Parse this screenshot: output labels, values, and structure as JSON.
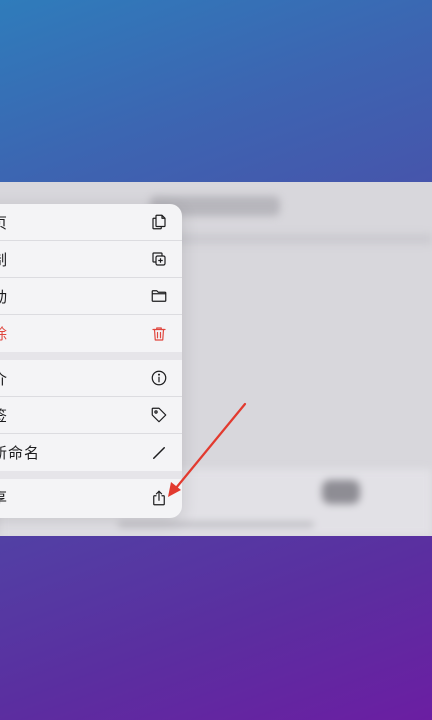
{
  "colors": {
    "danger": "#e0463e",
    "text": "#1c1c1e",
    "annotation_arrow": "#e23a2f"
  },
  "menu": {
    "groups": [
      {
        "items": [
          {
            "label": "页",
            "icon": "copy-pages-icon"
          },
          {
            "label": "制",
            "icon": "duplicate-icon"
          },
          {
            "label": "动",
            "icon": "folder-icon"
          },
          {
            "label": "除",
            "icon": "trash-icon",
            "danger": true
          }
        ]
      },
      {
        "items": [
          {
            "label": "介",
            "icon": "info-icon"
          },
          {
            "label": "签",
            "icon": "tag-icon"
          },
          {
            "label": "新命名",
            "icon": "pencil-icon"
          }
        ]
      },
      {
        "items": [
          {
            "label": "享",
            "icon": "share-icon"
          }
        ]
      }
    ]
  }
}
